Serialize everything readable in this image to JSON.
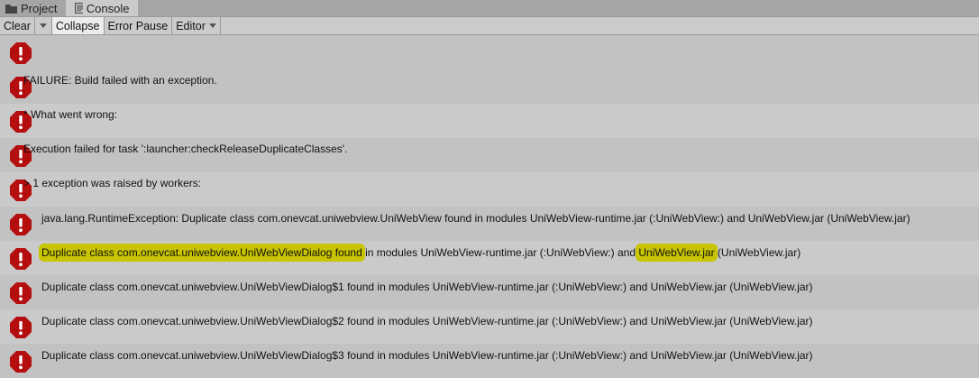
{
  "tabs": [
    {
      "label": "Project",
      "icon": "folder-icon"
    },
    {
      "label": "Console",
      "icon": "console-icon"
    }
  ],
  "toolbar": {
    "clear": "Clear",
    "collapse": "Collapse",
    "error_pause": "Error Pause",
    "editor": "Editor"
  },
  "colors": {
    "error": "#b50e0e",
    "highlight": "#c8c400"
  },
  "rows": [
    {
      "text": ""
    },
    {
      "text": "FAILURE: Build failed with an exception."
    },
    {
      "text": "* What went wrong:"
    },
    {
      "text": "Execution failed for task ':launcher:checkReleaseDuplicateClasses'."
    },
    {
      "text": "> 1 exception was raised by workers:"
    },
    {
      "text": "java.lang.RuntimeException: Duplicate class com.onevcat.uniwebview.UniWebView found in modules UniWebView-runtime.jar (:UniWebView:) and UniWebView.jar (UniWebView.jar)"
    },
    {
      "hl1": "Duplicate class com.onevcat.uniwebview.UniWebViewDialog found",
      "mid": " in modules UniWebView-runtime.jar (:UniWebView:) and ",
      "hl2": "UniWebView.jar",
      "end": " (UniWebView.jar)"
    },
    {
      "text": "Duplicate class com.onevcat.uniwebview.UniWebViewDialog$1 found in modules UniWebView-runtime.jar (:UniWebView:) and UniWebView.jar (UniWebView.jar)"
    },
    {
      "text": "Duplicate class com.onevcat.uniwebview.UniWebViewDialog$2 found in modules UniWebView-runtime.jar (:UniWebView:) and UniWebView.jar (UniWebView.jar)"
    },
    {
      "text": "Duplicate class com.onevcat.uniwebview.UniWebViewDialog$3 found in modules UniWebView-runtime.jar (:UniWebView:) and UniWebView.jar (UniWebView.jar)"
    }
  ]
}
